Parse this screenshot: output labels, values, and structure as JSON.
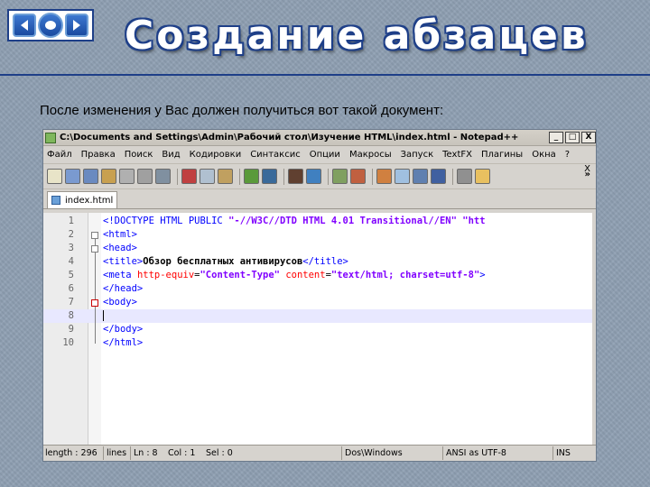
{
  "slide": {
    "title": "Создание абзацев",
    "subtitle": "После изменения у Вас должен получиться вот такой документ:"
  },
  "nav": {
    "back_icon": "arrow-left-icon",
    "home_icon": "home-icon",
    "forward_icon": "arrow-right-icon"
  },
  "window": {
    "title_path": "C:\\Documents and Settings\\Admin\\Рабочий стол\\Изучение HTML\\index.html - Notepad++",
    "min_label": "_",
    "max_label": "□",
    "close_label": "X",
    "menu": [
      "Файл",
      "Правка",
      "Поиск",
      "Вид",
      "Кодировки",
      "Синтаксис",
      "Опции",
      "Макросы",
      "Запуск",
      "TextFX",
      "Плагины",
      "Окна",
      "?"
    ],
    "menu_close": "X",
    "toolbar_more": "»",
    "tab_label": "index.html"
  },
  "editor": {
    "line_numbers": [
      "1",
      "2",
      "3",
      "4",
      "5",
      "6",
      "7",
      "8",
      "9",
      "10"
    ],
    "lines": [
      {
        "pre": "<!DOCTYPE HTML PUBLIC ",
        "str1": "\"-//W3C//DTD HTML 4.01 Transitional//EN\"",
        "post": " \"htt"
      },
      {
        "tag": "<html>"
      },
      {
        "tag": "<head>"
      },
      {
        "open": "<title>",
        "text": "Обзор бесплатных антивирусов",
        "close": "</title>"
      },
      {
        "open": "<meta ",
        "attr1": "http-equiv",
        "eq1": "=",
        "val1": "\"Content-Type\"",
        "attr2": " content",
        "eq2": "=",
        "val2": "\"text/html; charset=utf-8\"",
        "end": ">"
      },
      {
        "tag": "</head>"
      },
      {
        "tag": "<body>"
      },
      {
        "tag": ""
      },
      {
        "tag": "</body>"
      },
      {
        "tag": "</html>"
      }
    ]
  },
  "status": {
    "length": "length : 296",
    "lines": "lines",
    "ln": "Ln : 8",
    "col": "Col : 1",
    "sel": "Sel : 0",
    "eol": "Dos\\Windows",
    "encoding": "ANSI as UTF-8",
    "mode": "INS"
  }
}
